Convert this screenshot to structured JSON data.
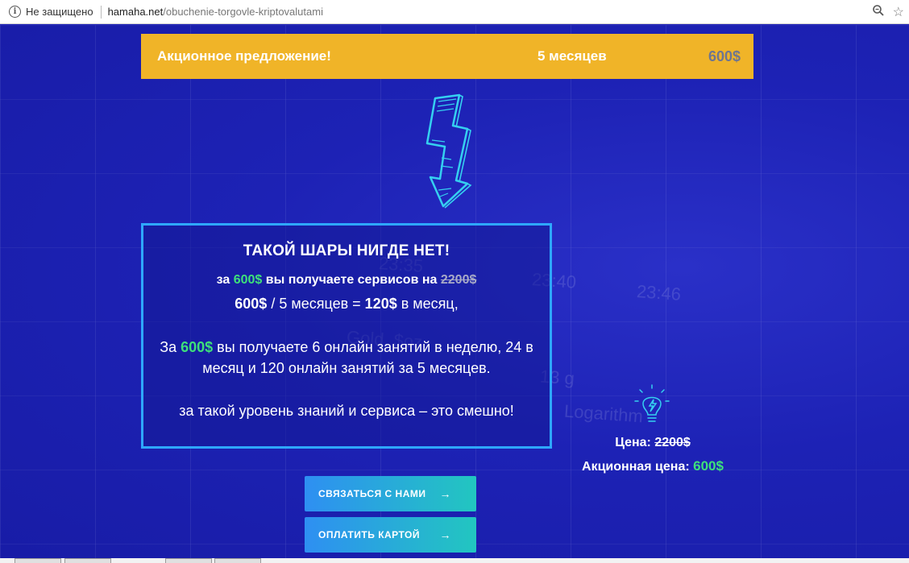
{
  "browser": {
    "security_label": "Не защищено",
    "url_host": "hamaha.net",
    "url_path": "/obuchenie-torgovle-kriptovalutami"
  },
  "promo": {
    "title": "Акционное предложение!",
    "months": "5 месяцев",
    "price": "600$"
  },
  "infobox": {
    "title": "ТАКОЙ ШАРЫ НИГДЕ НЕТ!",
    "line1_prefix": "за",
    "line1_price": "600$",
    "line1_middle": "вы получаете сервисов на",
    "line1_old": "2200$",
    "line2_a": "600$",
    "line2_b": "/ 5 месяцев =",
    "line2_c": "120$",
    "line2_d": "в месяц,",
    "para_prefix": "За",
    "para_price": "600$",
    "para_text": "вы получаете 6 онлайн занятий в неделю, 24 в месяц и 120 онлайн занятий за 5 месяцев.",
    "last": "за такой уровень знаний и сервиса – это смешно!"
  },
  "pricing": {
    "label_price": "Цена:",
    "old_price": "2200$",
    "label_promo": "Акционная цена:",
    "promo_price": "600$"
  },
  "buttons": {
    "contact": "СВЯЗАТЬСЯ С НАМИ",
    "pay": "ОПЛАТИТЬ КАРТОЙ",
    "arrow": "→"
  },
  "icons": {
    "info": "info-icon",
    "zoom": "zoom-icon",
    "star": "star-icon",
    "bolt": "lightning-bolt-icon",
    "bulb": "lightbulb-icon"
  },
  "colors": {
    "background": "#1e22b8",
    "promo_bar": "#f0b428",
    "accent_green": "#3ee07a",
    "box_border": "#2ea7ff",
    "button_start": "#2e8ff2",
    "button_end": "#22c6c0"
  }
}
